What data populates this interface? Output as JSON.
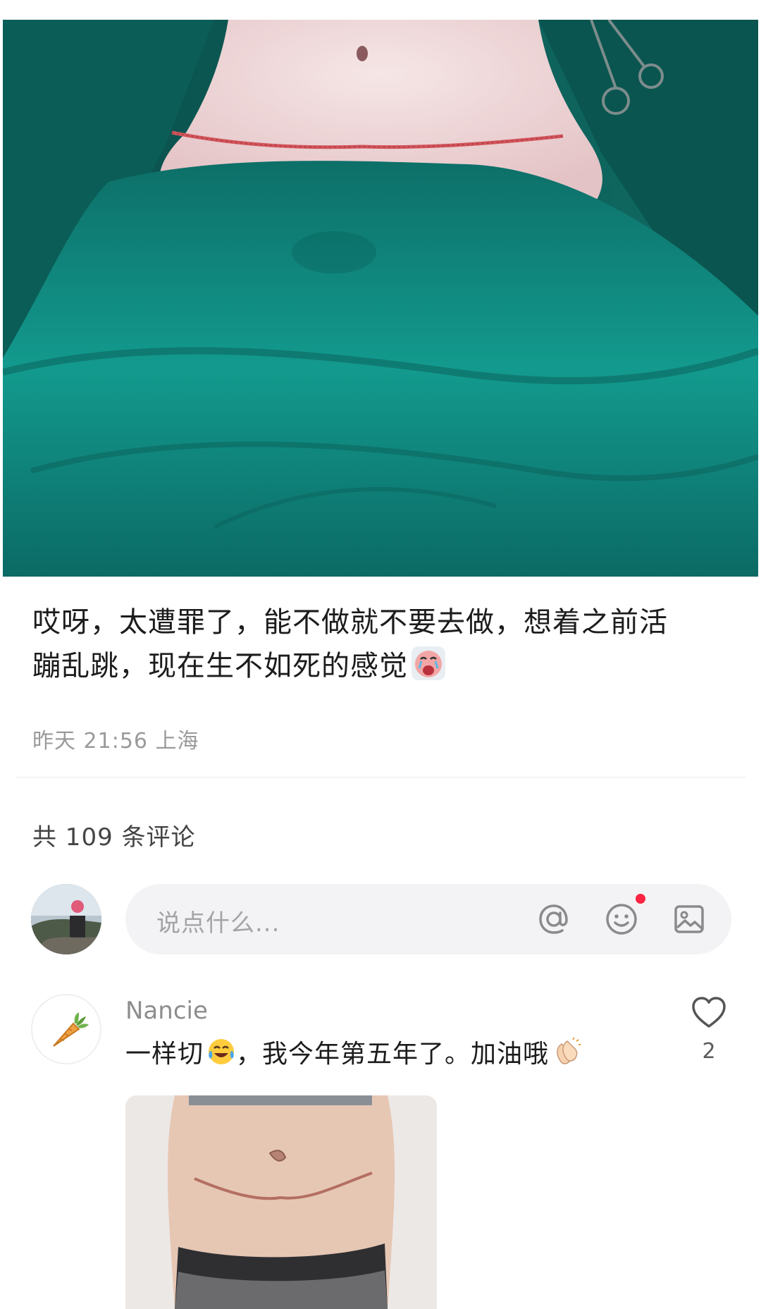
{
  "post": {
    "photo_icon": "post-photo",
    "caption_line1": "哎呀，太遭罪了，能不做就不要去做，想着之前活",
    "caption_line2": "蹦乱跳，现在生不如死的感觉",
    "caption_emoji": "crying-face-emoji",
    "meta": "昨天 21:56 上海"
  },
  "comments_header": {
    "count_label": "共 109 条评论"
  },
  "comment_input": {
    "avatar_icon": "user-avatar",
    "placeholder": "说点什么...",
    "icons": [
      "at-icon",
      "emoji-icon",
      "image-icon"
    ],
    "emoji_badge_color": "#ff2442"
  },
  "comments": [
    {
      "username": "Nancie",
      "avatar_icon": "carrot-icon",
      "text_part1": "一样切",
      "emoji1": "tears-of-joy-emoji",
      "text_part2": "，我今年第五年了。加油哦",
      "emoji2": "clapping-hands-emoji",
      "likes": "2",
      "attached_photo": "comment-photo"
    }
  ]
}
